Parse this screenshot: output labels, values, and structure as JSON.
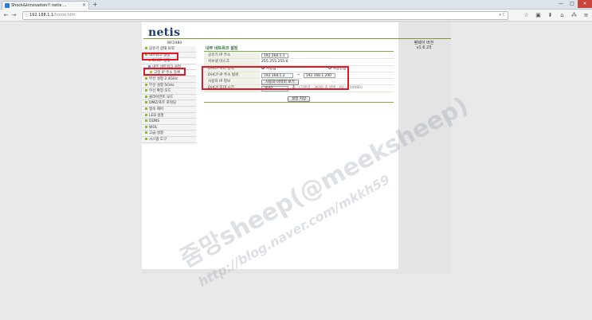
{
  "browser": {
    "tab_title": "Shock&Innovation!! netis ...",
    "tab_close": "×",
    "new_tab": "+",
    "window_buttons": [
      "—",
      "□",
      "×"
    ],
    "url_host": "192.168.1.1",
    "url_path": "/home.htm",
    "nav": {
      "back": "←",
      "forward": "→",
      "home": "⌂",
      "reload": "C"
    },
    "url_icons": "▾ C",
    "toolbar_icons": [
      "☆",
      "▣",
      "⬇",
      "⌂",
      "⁂",
      "≡"
    ]
  },
  "page": {
    "logo": "netis",
    "model": "WF2480",
    "firmware_label": "펌웨어 버전",
    "firmware_version": "v1.6.23",
    "sidebar": [
      {
        "label": "공유기 상태 요약",
        "level": 0,
        "icon": "green"
      },
      {
        "label": "네트워크 설정",
        "level": 0,
        "icon": "green"
      },
      {
        "label": "DHCP 설정",
        "level": 1,
        "icon": "yellow"
      },
      {
        "label": "내부 네트워크 설정",
        "level": 1,
        "icon": "blue"
      },
      {
        "label": "고정 IP 주소 등록",
        "level": 2,
        "icon": "yellow"
      },
      {
        "label": "무선 설정 2.4GHz",
        "level": 0,
        "icon": "green"
      },
      {
        "label": "무선 설정 5GHz",
        "level": 0,
        "icon": "green"
      },
      {
        "label": "무선 확장 모드",
        "level": 0,
        "icon": "green"
      },
      {
        "label": "클라이언트 모드",
        "level": 0,
        "icon": "green"
      },
      {
        "label": "DMZ/포트 포워딩",
        "level": 0,
        "icon": "green"
      },
      {
        "label": "접속 제어",
        "level": 0,
        "icon": "green"
      },
      {
        "label": "LED 설정",
        "level": 0,
        "icon": "green"
      },
      {
        "label": "DDNS",
        "level": 0,
        "icon": "green"
      },
      {
        "label": "WOL",
        "level": 0,
        "icon": "green"
      },
      {
        "label": "고급 설정",
        "level": 0,
        "icon": "green"
      },
      {
        "label": "시스템 도구",
        "level": 0,
        "icon": "green"
      }
    ],
    "section_title": "내부 네트워크 설정",
    "form": {
      "ip_label": "공유기 IP 주소",
      "ip_value": "192.168.1.1",
      "subnet_label": "서브넷 마스크",
      "subnet_value": "255.255.255.0",
      "dhcp_label": "DHCP 서버 동작",
      "dhcp_on": "사용함",
      "dhcp_off": "사용안함",
      "range_label": "DHCP IP 주소 범위",
      "range_start": "192.168.1.2",
      "range_sep": "~",
      "range_end": "192.168.1.200",
      "clients_label": "사용자 IP 정보",
      "clients_button": "사용자 아이피 보기",
      "lease_label": "DHCP 임대 시간",
      "lease_value": "3600",
      "lease_unit": "초",
      "lease_hint": "(기본값 : 3600 초 범위 : 60 ~ 10080)",
      "save_button": "설정 저장"
    },
    "watermark_1": "줌망sheep(@meeksheep)",
    "watermark_2": "http://blog.naver.com/mkkh59"
  }
}
